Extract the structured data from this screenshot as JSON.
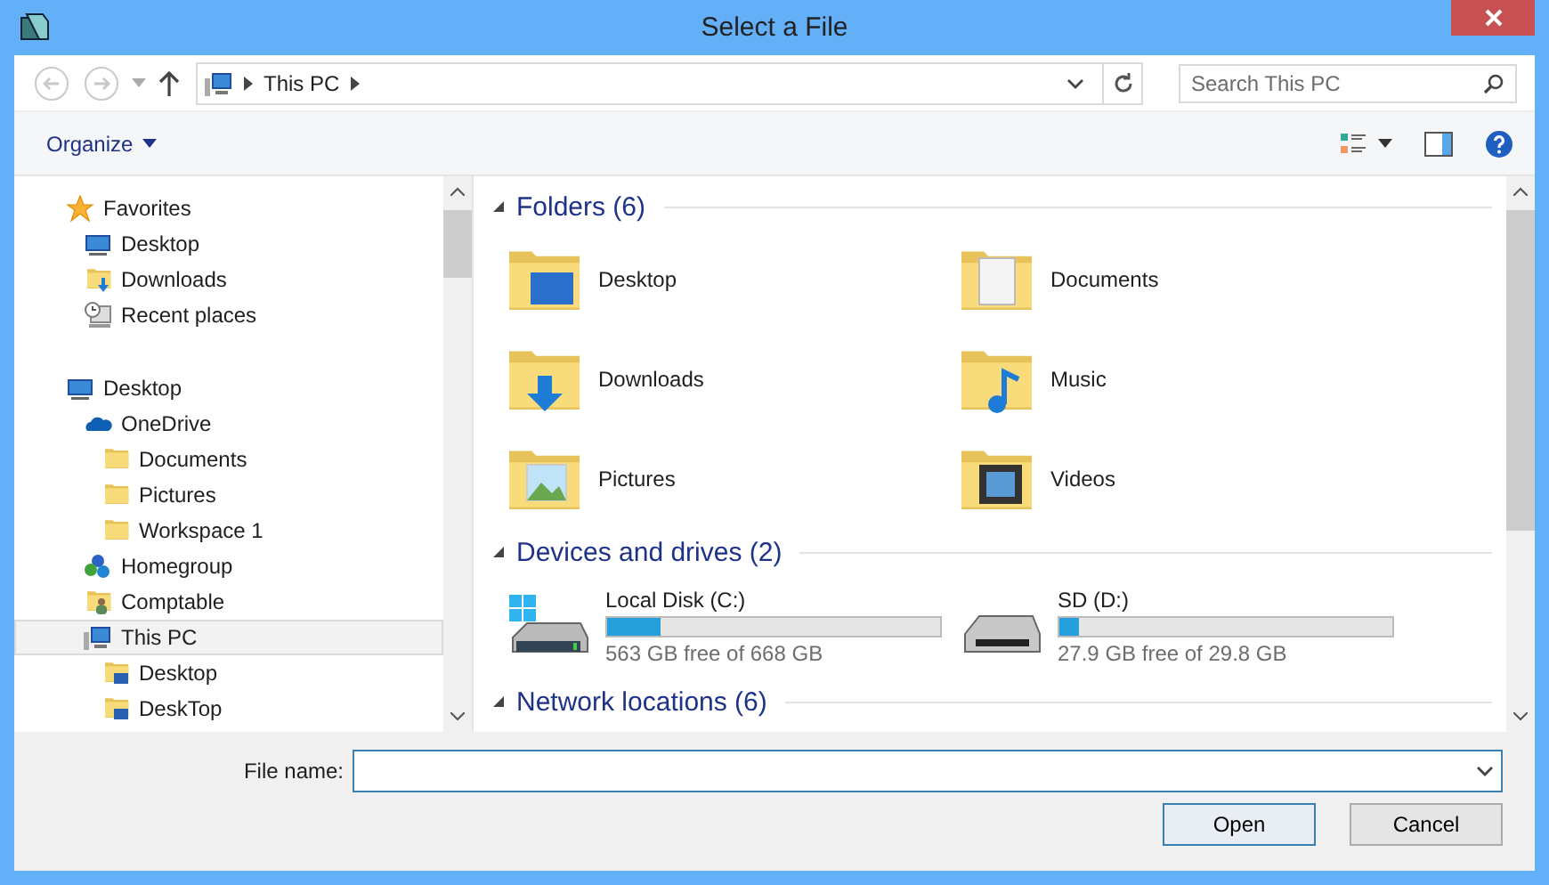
{
  "window": {
    "title": "Select a File"
  },
  "nav": {
    "back_disabled": true,
    "forward_disabled": true,
    "breadcrumb": [
      "This PC"
    ],
    "search": {
      "placeholder": "Search This PC"
    }
  },
  "toolbar": {
    "organize": "Organize"
  },
  "sidebar": {
    "items": [
      {
        "label": "Favorites",
        "kind": "star",
        "selected": false,
        "children": [
          {
            "label": "Desktop",
            "kind": "monitor",
            "selected": false
          },
          {
            "label": "Downloads",
            "kind": "download-folder",
            "selected": false
          },
          {
            "label": "Recent places",
            "kind": "recent",
            "selected": false
          }
        ]
      },
      {
        "label": "Desktop",
        "kind": "monitor",
        "selected": false,
        "children": [
          {
            "label": "OneDrive",
            "kind": "cloud",
            "selected": false,
            "children": [
              {
                "label": "Documents",
                "kind": "folder",
                "selected": false
              },
              {
                "label": "Pictures",
                "kind": "folder",
                "selected": false
              },
              {
                "label": "Workspace 1",
                "kind": "folder",
                "selected": false
              }
            ]
          },
          {
            "label": "Homegroup",
            "kind": "network",
            "selected": false
          },
          {
            "label": "Comptable",
            "kind": "user-folder",
            "selected": false
          },
          {
            "label": "This PC",
            "kind": "pc",
            "selected": true,
            "children": [
              {
                "label": "Desktop",
                "kind": "monitor-folder",
                "selected": false
              },
              {
                "label": "DeskTop",
                "kind": "monitor-folder",
                "selected": false
              }
            ]
          }
        ]
      }
    ]
  },
  "groups": [
    {
      "title": "Folders (6)",
      "kind": "folders",
      "expanded": true,
      "items": [
        {
          "name": "Desktop",
          "kind": "desktop"
        },
        {
          "name": "Documents",
          "kind": "documents"
        },
        {
          "name": "Downloads",
          "kind": "downloads"
        },
        {
          "name": "Music",
          "kind": "music"
        },
        {
          "name": "Pictures",
          "kind": "pictures"
        },
        {
          "name": "Videos",
          "kind": "videos"
        }
      ]
    },
    {
      "title": "Devices and drives (2)",
      "kind": "drives",
      "expanded": true,
      "items": [
        {
          "name": "Local Disk (C:)",
          "kind": "system",
          "level": 0.16,
          "free": "563 GB free of 668 GB"
        },
        {
          "name": "SD (D:)",
          "kind": "removable",
          "level": 0.06,
          "free": "27.9 GB free of 29.8 GB"
        }
      ]
    },
    {
      "title": "Network locations (6)",
      "kind": "network",
      "expanded": true
    }
  ],
  "footer": {
    "file_name_label": "File name:",
    "focused": true,
    "buttons": [
      {
        "label": "Open",
        "default": true
      },
      {
        "label": "Cancel",
        "default": false
      }
    ]
  }
}
